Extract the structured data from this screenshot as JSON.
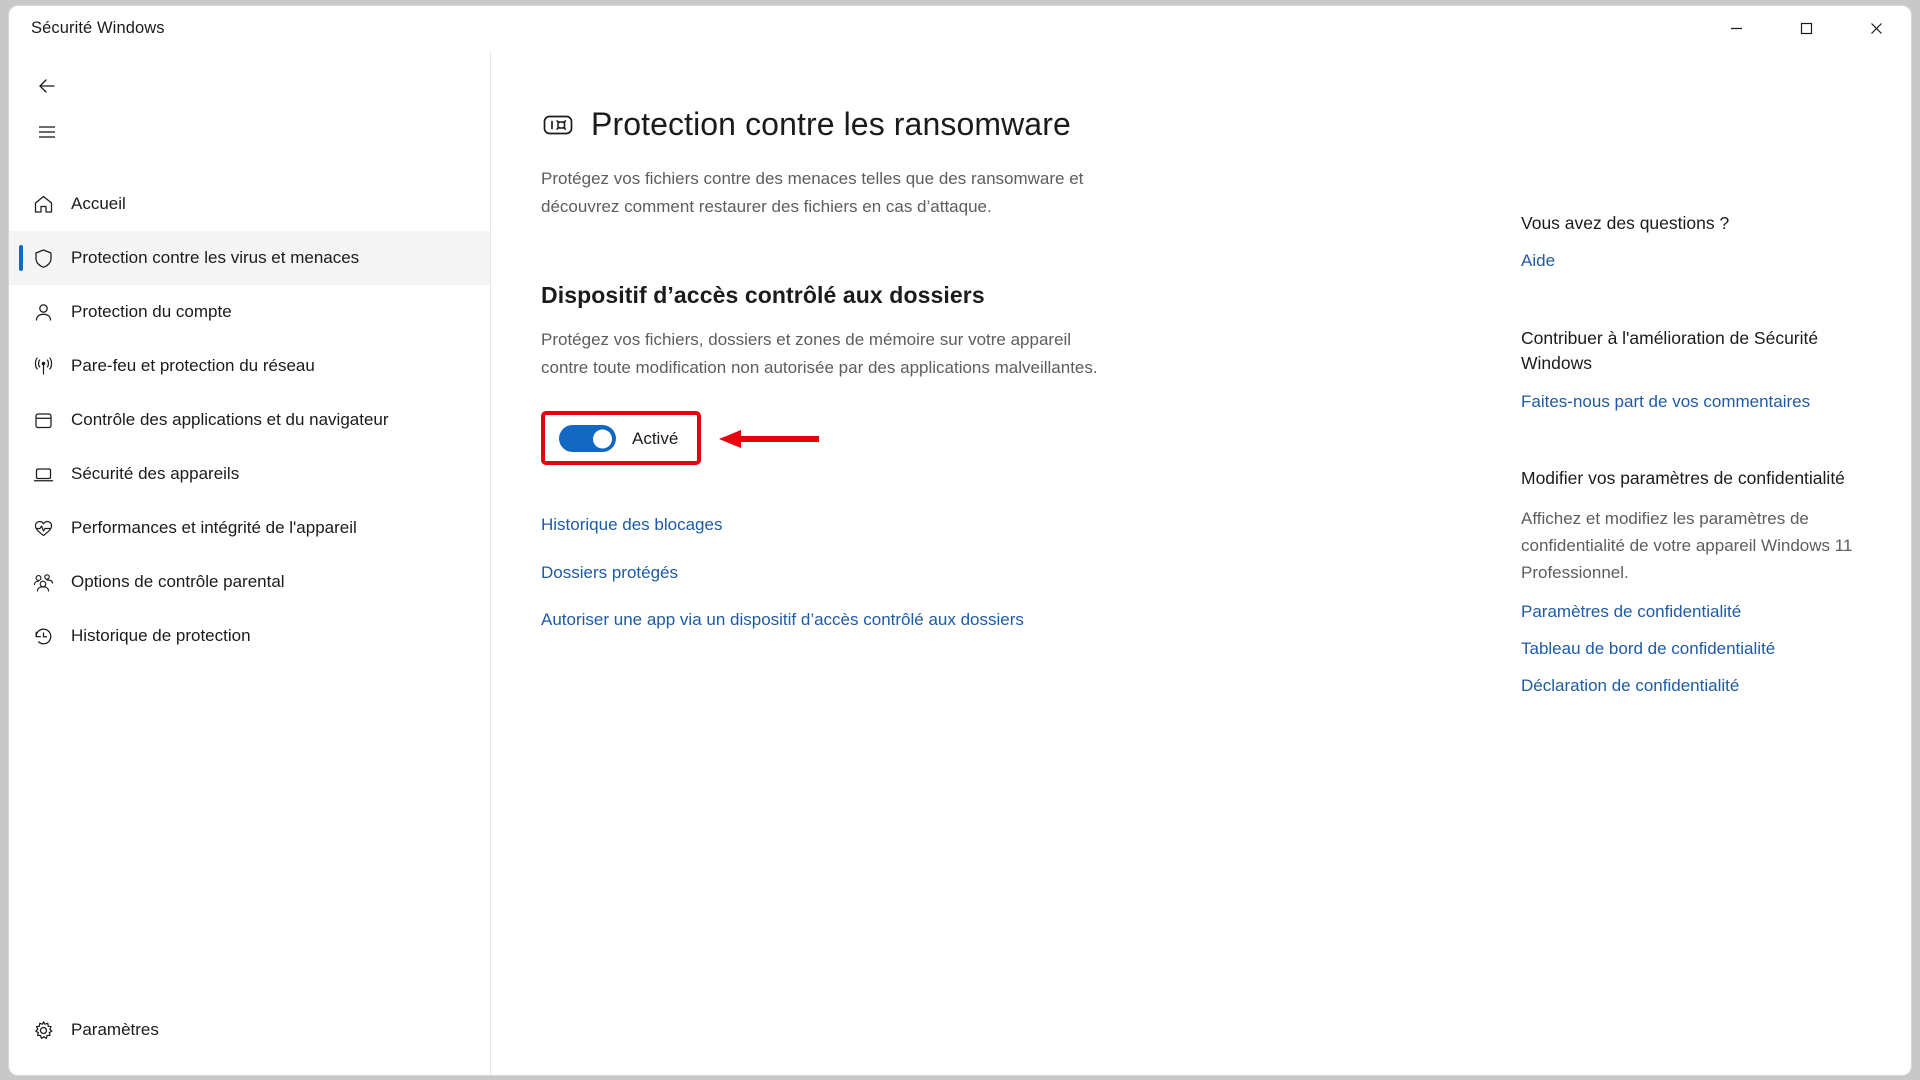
{
  "window": {
    "title": "Sécurité Windows",
    "controls": {
      "minimize": "−",
      "maximize": "□",
      "close": "✕"
    }
  },
  "sidebar": {
    "back_label": "back-arrow",
    "menu_label": "hamburger-menu",
    "items": [
      {
        "label": "Accueil",
        "icon": "home-icon",
        "selected": false
      },
      {
        "label": "Protection contre les virus et menaces",
        "icon": "shield-icon",
        "selected": true
      },
      {
        "label": "Protection du compte",
        "icon": "person-icon",
        "selected": false
      },
      {
        "label": "Pare-feu et protection du réseau",
        "icon": "wifi-icon",
        "selected": false
      },
      {
        "label": "Contrôle des applications et du navigateur",
        "icon": "browser-icon",
        "selected": false
      },
      {
        "label": "Sécurité des appareils",
        "icon": "laptop-icon",
        "selected": false
      },
      {
        "label": "Performances et intégrité de l'appareil",
        "icon": "heartbeat-icon",
        "selected": false
      },
      {
        "label": "Options de contrôle parental",
        "icon": "family-icon",
        "selected": false
      },
      {
        "label": "Historique de protection",
        "icon": "history-icon",
        "selected": false
      }
    ],
    "settings": {
      "label": "Paramètres",
      "icon": "gear-icon"
    }
  },
  "main": {
    "page_icon": "ransomware-icon",
    "page_title": "Protection contre les ransomware",
    "page_description": "Protégez vos fichiers contre des menaces telles que des ransomware et découvrez comment restaurer des fichiers en cas d’attaque.",
    "section": {
      "title": "Dispositif d’accès contrôlé aux dossiers",
      "description": "Protégez vos fichiers, dossiers et zones de mémoire sur votre appareil contre toute modification non autorisée par des applications malveillantes.",
      "toggle": {
        "state_label": "Activé",
        "is_on": true,
        "highlight_color": "#e8000d",
        "accent_color": "#1268c3"
      },
      "links": [
        "Historique des blocages",
        "Dossiers protégés",
        "Autoriser une app via un dispositif d’accès contrôlé aux dossiers"
      ]
    }
  },
  "right_panel": {
    "blocks": [
      {
        "title": "Vous avez des questions ?",
        "description": "",
        "links": [
          "Aide"
        ]
      },
      {
        "title": "Contribuer à l'amélioration de Sécurité Windows",
        "description": "",
        "links": [
          "Faites-nous part de vos commentaires"
        ]
      },
      {
        "title": "Modifier vos paramètres de confidentialité",
        "description": "Affichez et modifiez les paramètres de confidentialité de votre appareil Windows 11 Professionnel.",
        "links": [
          "Paramètres de confidentialité",
          "Tableau de bord de confidentialité",
          "Déclaration de confidentialité"
        ]
      }
    ]
  },
  "colors": {
    "accent": "#0f6cbd",
    "link": "#1f5ba4",
    "annotation": "#e8000d",
    "text": "#1b1b1b",
    "muted": "#5d5d5d"
  }
}
